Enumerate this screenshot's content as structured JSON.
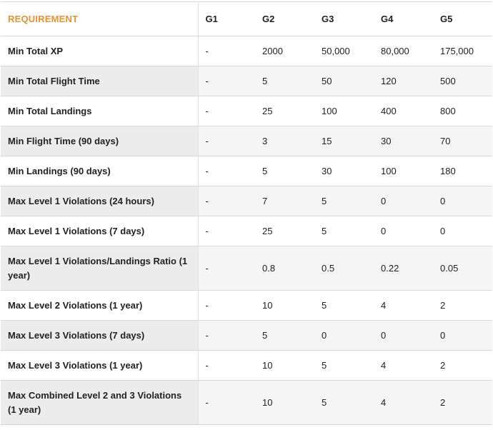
{
  "table": {
    "headers": [
      "REQUIREMENT",
      "G1",
      "G2",
      "G3",
      "G4",
      "G5"
    ],
    "rows": [
      {
        "label": "Min Total XP",
        "values": [
          "-",
          "2000",
          "50,000",
          "80,000",
          "175,000"
        ]
      },
      {
        "label": "Min Total Flight Time",
        "values": [
          "-",
          "5",
          "50",
          "120",
          "500"
        ]
      },
      {
        "label": "Min Total Landings",
        "values": [
          "-",
          "25",
          "100",
          "400",
          "800"
        ]
      },
      {
        "label": "Min Flight Time (90 days)",
        "values": [
          "-",
          "3",
          "15",
          "30",
          "70"
        ]
      },
      {
        "label": "Min Landings (90 days)",
        "values": [
          "-",
          "5",
          "30",
          "100",
          "180"
        ]
      },
      {
        "label": "Max Level 1 Violations (24 hours)",
        "values": [
          "-",
          "7",
          "5",
          "0",
          "0"
        ]
      },
      {
        "label": "Max Level 1 Violations (7 days)",
        "values": [
          "-",
          "25",
          "5",
          "0",
          "0"
        ]
      },
      {
        "label": "Max Level 1 Violations/Landings Ratio (1 year)",
        "values": [
          "-",
          "0.8",
          "0.5",
          "0.22",
          "0.05"
        ]
      },
      {
        "label": "Max Level 2 Violations (1 year)",
        "values": [
          "-",
          "10",
          "5",
          "4",
          "2"
        ]
      },
      {
        "label": "Max Level 3 Violations (7 days)",
        "values": [
          "-",
          "5",
          "0",
          "0",
          "0"
        ]
      },
      {
        "label": "Max Level 3 Violations (1 year)",
        "values": [
          "-",
          "10",
          "5",
          "4",
          "2"
        ]
      },
      {
        "label": "Max Combined Level 2 and 3 Violations (1 year)",
        "values": [
          "-",
          "10",
          "5",
          "4",
          "2"
        ]
      }
    ]
  },
  "colors": {
    "header_accent": "#e8912f",
    "row_alt": "#f5f5f5",
    "border": "#d9d9d9"
  }
}
